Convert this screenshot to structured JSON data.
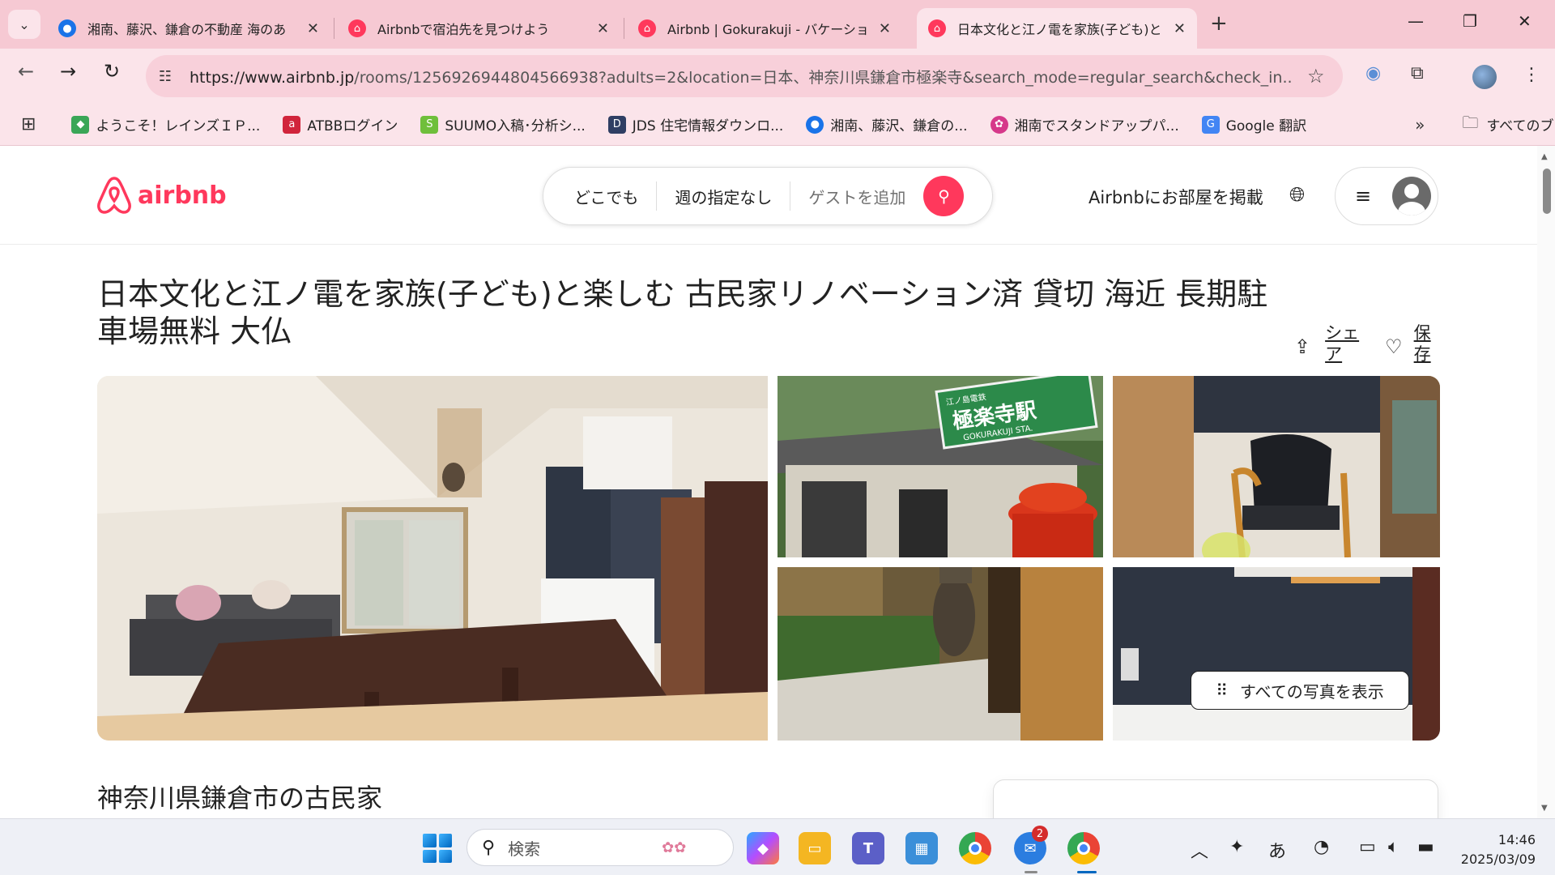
{
  "browser": {
    "tabs": [
      {
        "title": "湘南、藤沢、鎌倉の不動産 海のあ",
        "active": false
      },
      {
        "title": "Airbnbで宿泊先を見つけよう",
        "active": false
      },
      {
        "title": "Airbnb | Gokurakuji - バケーション",
        "active": false
      },
      {
        "title": "日本文化と江ノ電を家族(子ども)と",
        "active": true
      }
    ],
    "url_host": "https://www.airbnb.jp",
    "url_rest": "/rooms/1256926944804566938?adults=2&location=日本、神奈川県鎌倉市極楽寺&search_mode=regular_search&check_in...",
    "bookmarks": [
      {
        "label": "ようこそ！レインズＩＰ..."
      },
      {
        "label": "ATBBログイン"
      },
      {
        "label": "SUUMO入稿･分析シ..."
      },
      {
        "label": "JDS 住宅情報ダウンロ..."
      },
      {
        "label": "湘南、藤沢、鎌倉の..."
      },
      {
        "label": "湘南でスタンドアップパ..."
      },
      {
        "label": "Google 翻訳"
      }
    ],
    "all_bookmarks": "すべてのブックマーク"
  },
  "header": {
    "logo_text": "airbnb",
    "search": {
      "where": "どこでも",
      "when": "週の指定なし",
      "guests": "ゲストを追加"
    },
    "host_link": "Airbnbにお部屋を掲載"
  },
  "listing": {
    "title": "日本文化と江ノ電を家族(子ども)と楽しむ 古民家リノベーション済 貸切 海近 長期駐車場無料 大仏",
    "share_label": "シェア",
    "save_label": "保存",
    "show_all_photos": "すべての写真を表示",
    "subtitle": "神奈川県鎌倉市の古民家",
    "photo_sign_top": "江ノ島電鉄",
    "photo_sign_main": "極楽寺駅",
    "photo_sign_sub": "GOKURAKUJI STA."
  },
  "taskbar": {
    "search_placeholder": "検索",
    "badge_count": "2",
    "ime": "あ",
    "time": "14:46",
    "date": "2025/03/09"
  },
  "colors": {
    "brand": "#ff385c",
    "tab_strip": "#f6c9d3",
    "toolbar": "#fbe4ea"
  }
}
